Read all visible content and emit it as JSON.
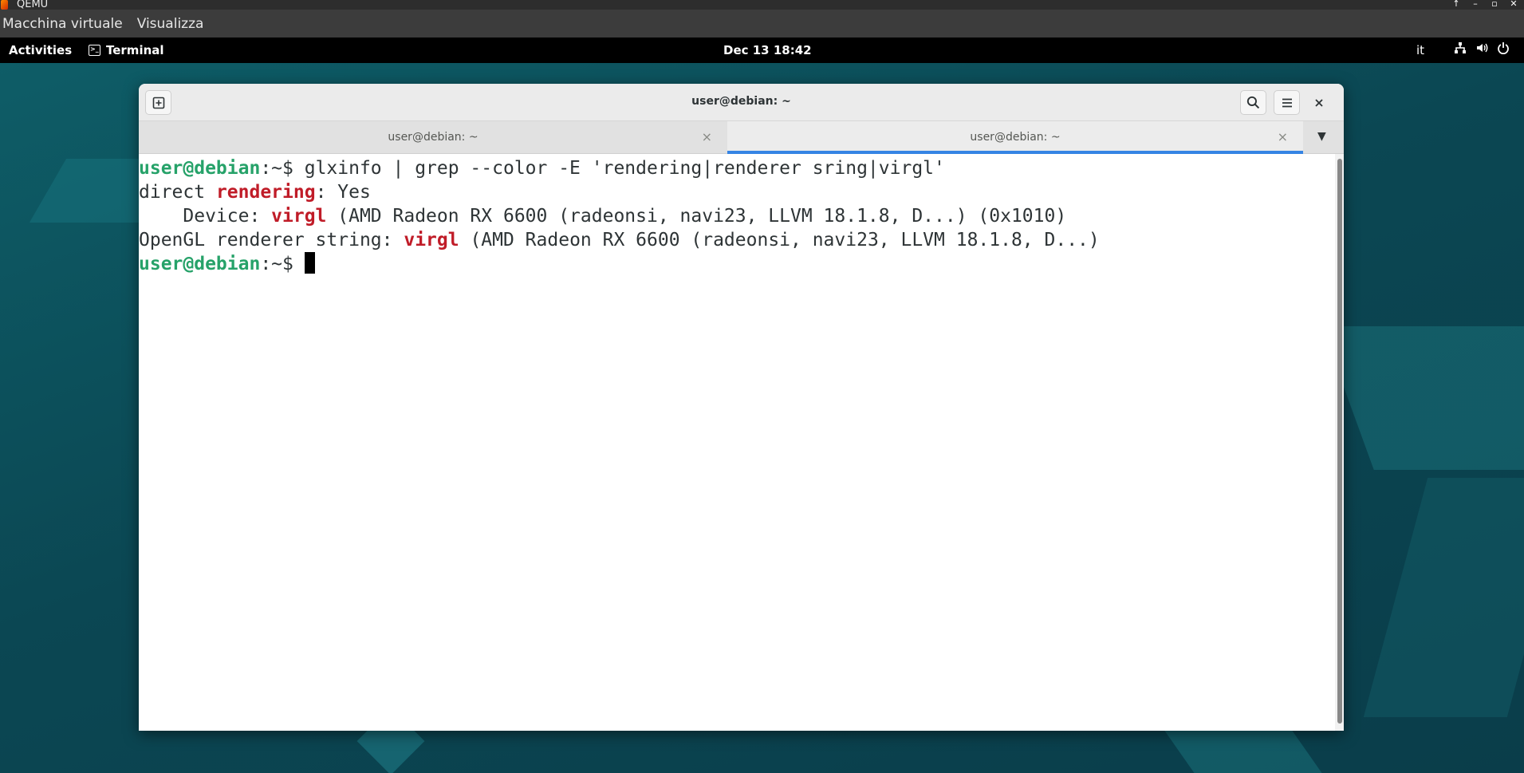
{
  "qemu": {
    "title": "QEMU",
    "menu": [
      "Macchina virtuale",
      "Visualizza"
    ],
    "window_buttons": [
      "↑",
      "–",
      "▫",
      "✕"
    ]
  },
  "gnome_bar": {
    "activities": "Activities",
    "app_name": "Terminal",
    "clock": "Dec 13  18:42",
    "keyboard_layout": "it",
    "tray_icons": [
      "network-icon",
      "volume-icon",
      "power-icon"
    ]
  },
  "terminal": {
    "title": "user@debian: ~",
    "tabs": [
      {
        "label": "user@debian: ~",
        "active": false
      },
      {
        "label": "user@debian: ~",
        "active": true
      }
    ],
    "lines": [
      {
        "prompt": "user@debian",
        "sep": ":~$ ",
        "command": "glxinfo | grep --color -E 'rendering|renderer sring|virgl'"
      },
      {
        "pre": "direct ",
        "hl": "rendering",
        "post": ": Yes"
      },
      {
        "pre": "    Device: ",
        "hl": "virgl",
        "post": " (AMD Radeon RX 6600 (radeonsi, navi23, LLVM 18.1.8, D...) (0x1010)"
      },
      {
        "pre": "OpenGL renderer string: ",
        "hl": "virgl",
        "post": " (AMD Radeon RX 6600 (radeonsi, navi23, LLVM 18.1.8, D...)"
      },
      {
        "prompt": "user@debian",
        "sep": ":~$ ",
        "command": ""
      }
    ]
  },
  "colors": {
    "prompt_green": "#26a269",
    "match_red": "#c01c28",
    "tab_accent": "#3584e4"
  }
}
